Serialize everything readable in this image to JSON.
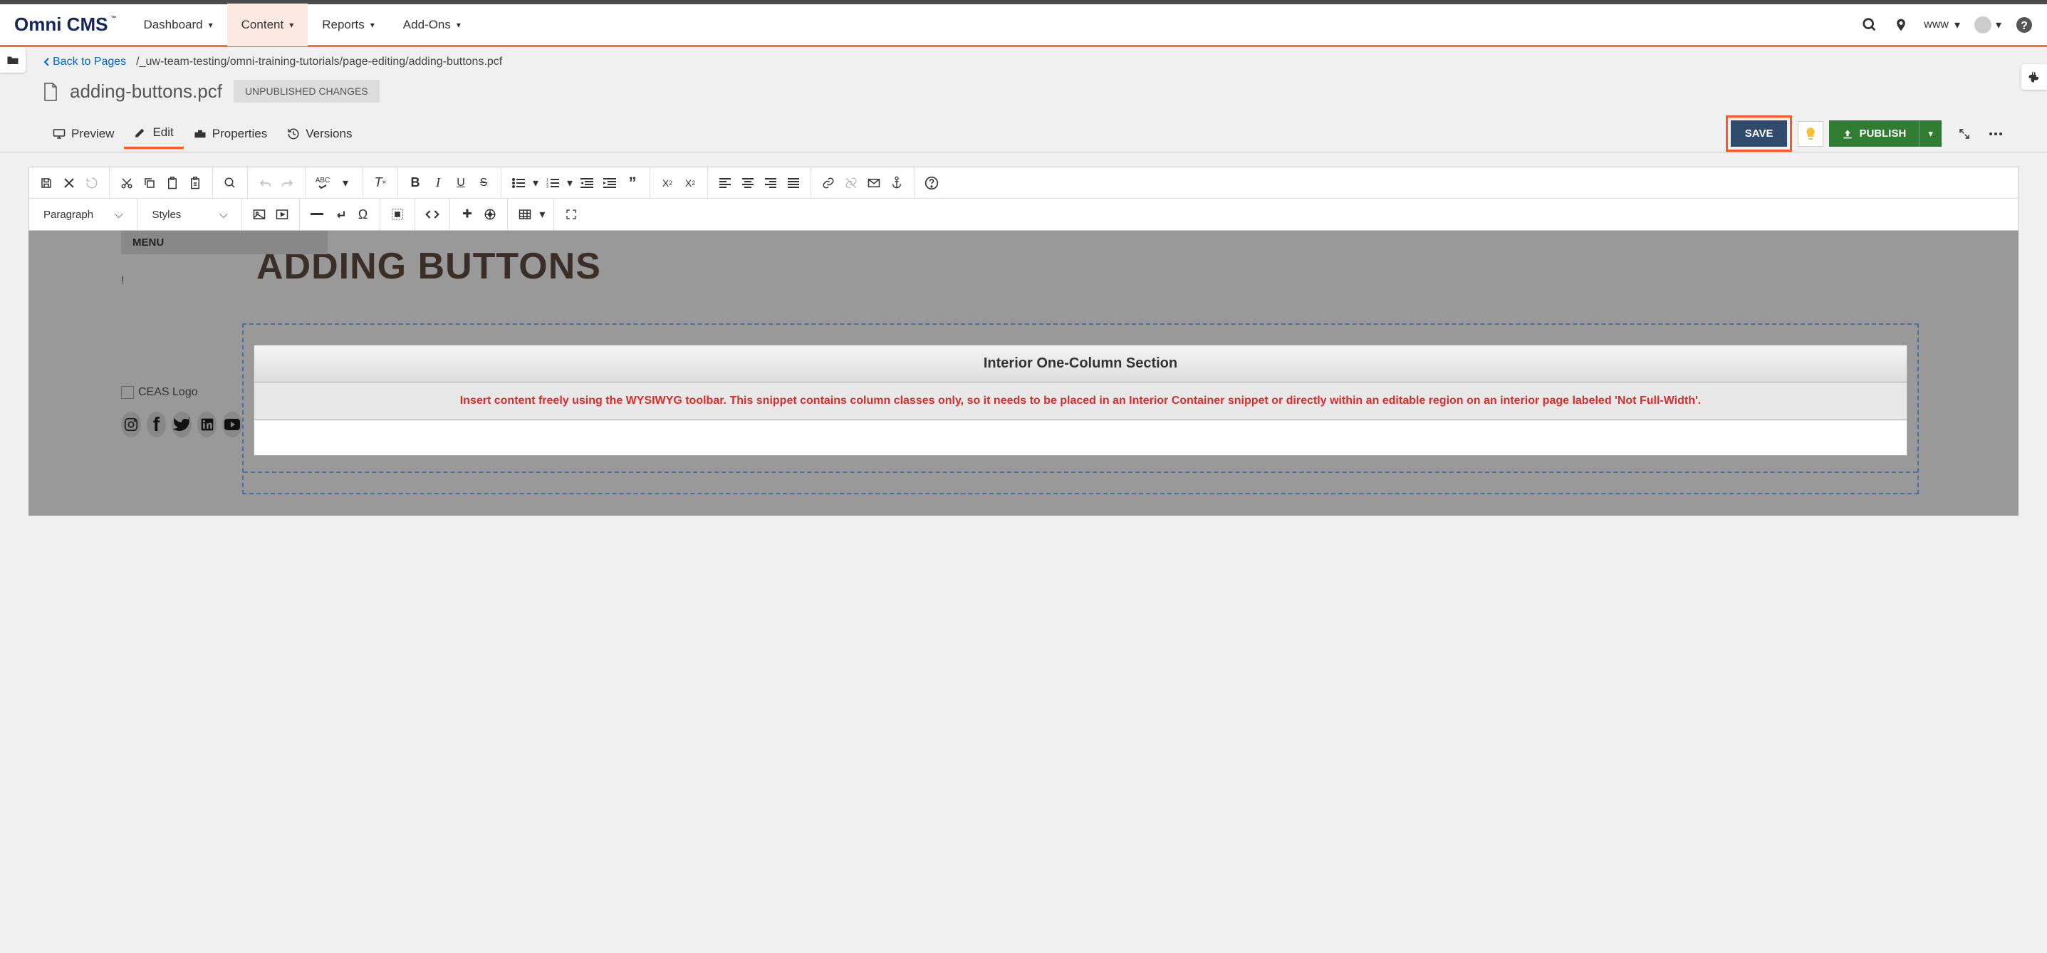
{
  "brand": "Omni CMS",
  "nav": {
    "dashboard": "Dashboard",
    "content": "Content",
    "reports": "Reports",
    "addons": "Add-Ons"
  },
  "site_selector": "www",
  "back_link": "Back to Pages",
  "breadcrumb": "/_uw-team-testing/omni-training-tutorials/page-editing/adding-buttons.pcf",
  "file_name": "adding-buttons.pcf",
  "status_badge": "UNPUBLISHED CHANGES",
  "tabs": {
    "preview": "Preview",
    "edit": "Edit",
    "properties": "Properties",
    "versions": "Versions"
  },
  "actions": {
    "save": "SAVE",
    "publish": "PUBLISH"
  },
  "editor_selects": {
    "paragraph": "Paragraph",
    "styles": "Styles"
  },
  "canvas": {
    "menu": "MENU",
    "warn": "!",
    "logo_alt": "CEAS Logo",
    "heading": "ADDING BUTTONS",
    "snippet_title": "Interior One-Column Section",
    "snippet_desc": "Insert content freely using the WYSIWYG toolbar. This snippet contains column classes only, so it needs to be placed in an Interior Container snippet or directly within an editable region on an interior page labeled 'Not Full-Width'."
  }
}
